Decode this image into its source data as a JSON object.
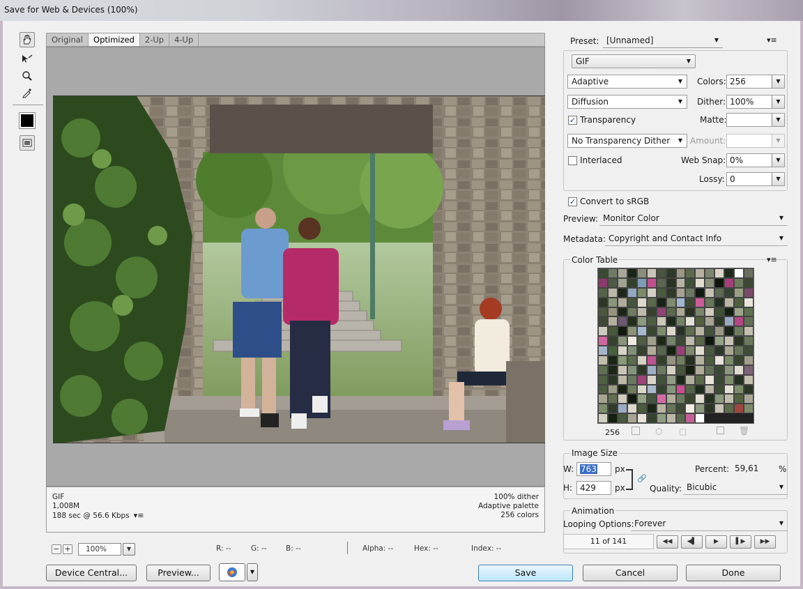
{
  "window": {
    "title": "Save for Web & Devices (100%)"
  },
  "view_tabs": [
    {
      "label": "Original"
    },
    {
      "label": "Optimized"
    },
    {
      "label": "2-Up"
    },
    {
      "label": "4-Up"
    }
  ],
  "preview_status": {
    "format": "GIF",
    "size": "1,008M",
    "time": "188 sec @ 56.6 Kbps",
    "dither": "100% dither",
    "palette": "Adaptive palette",
    "colors": "256 colors"
  },
  "zoom_bar": {
    "zoom": "100%",
    "r": "R: --",
    "g": "G: --",
    "b": "B: --",
    "alpha": "Alpha: --",
    "hex": "Hex: --",
    "index": "Index: --"
  },
  "settings": {
    "preset_label": "Preset:",
    "preset_value": "[Unnamed]",
    "format": "GIF",
    "reduction": "Adaptive",
    "colors_label": "Colors:",
    "colors_value": "256",
    "dither_algo": "Diffusion",
    "dither_label": "Dither:",
    "dither_value": "100%",
    "transparency_label": "Transparency",
    "transparency_checked": true,
    "matte_label": "Matte:",
    "matte_value": "",
    "transparency_dither": "No Transparency Dither",
    "amount_label": "Amount:",
    "amount_value": "",
    "interlaced_label": "Interlaced",
    "interlaced_checked": false,
    "websnap_label": "Web Snap:",
    "websnap_value": "0%",
    "lossy_label": "Lossy:",
    "lossy_value": "0",
    "convert_srgb_label": "Convert to sRGB",
    "convert_srgb_checked": true,
    "preview_label": "Preview:",
    "preview_value": "Monitor Color",
    "metadata_label": "Metadata:",
    "metadata_value": "Copyright and Contact Info"
  },
  "color_table": {
    "title": "Color Table",
    "count": "256",
    "swatches": [
      "#3a4a33",
      "#6e7a66",
      "#a9a79a",
      "#1a2418",
      "#8a8f7c",
      "#c9c4b6",
      "#4a5240",
      "#2e3828",
      "#9c9685",
      "#5d6a4e",
      "#b5b0a0",
      "#7a8470",
      "#d9d4c8",
      "#202a1c",
      "#ffffff",
      "#6a6f5e",
      "#8c3a6e",
      "#4d5a45",
      "#a0a48f",
      "#33402c",
      "#7e9bb8",
      "#c24f8d",
      "#5c6650",
      "#2a3322",
      "#b6b3a2",
      "#415038",
      "#e0dcd0",
      "#89917a",
      "#0e150c",
      "#a83d7c",
      "#6d7c5d",
      "#3b4732",
      "#566349",
      "#bcb8a8",
      "#1e281a",
      "#93a7c2",
      "#7c8a66",
      "#d3cfc2",
      "#4a5a3e",
      "#2f3a28",
      "#a5a291",
      "#6a7860",
      "#111a10",
      "#c6c2b3",
      "#5e6b53",
      "#364330",
      "#98a083",
      "#7b4a6a",
      "#2c3626",
      "#8a967a",
      "#b0ad9c",
      "#46563e",
      "#ddd8cc",
      "#5a6a4b",
      "#192216",
      "#7f8c6f",
      "#a3b6cf",
      "#3e4b35",
      "#ce5c9a",
      "#69775b",
      "#252f20",
      "#b9b6a5",
      "#51613f",
      "#e8e4da",
      "#4b573f",
      "#96937f",
      "#1c2518",
      "#6f7c61",
      "#c0bcad",
      "#35412e",
      "#8e4572",
      "#5b684f",
      "#aba896",
      "#28321f",
      "#7a866b",
      "#d0ccbe",
      "#405034",
      "#14200f",
      "#9ea58a",
      "#60704f",
      "#3d4936",
      "#b2af9e",
      "#6b5a70",
      "#232d1e",
      "#8f9a7e",
      "#4e5d42",
      "#cac6b8",
      "#1f2a19",
      "#738366",
      "#e4e0d6",
      "#52603f",
      "#a7a493",
      "#2e3827",
      "#99aac0",
      "#b74585",
      "#617057",
      "#cdc9bb",
      "#48583c",
      "#121a0f",
      "#8b9477",
      "#a6b8d1",
      "#39462f",
      "#7d8b6a",
      "#dcd8cc",
      "#283224",
      "#5f6d51",
      "#b8b4a3",
      "#43523a",
      "#9a9783",
      "#1a2316",
      "#6e7d60",
      "#c3bfaf",
      "#d1669f",
      "#364230",
      "#88937a",
      "#efebe2",
      "#4f5d44",
      "#a29f8d",
      "#1e2819",
      "#74836a",
      "#3b4834",
      "#bfbbab",
      "#5a6748",
      "#0f170d",
      "#91a485",
      "#c7c3b4",
      "#2b3524",
      "#6c7a5c",
      "#a4b5ca",
      "#466040",
      "#d7d3c6",
      "#82907a",
      "#33402b",
      "#b0ad9a",
      "#576650",
      "#16200f",
      "#9b3f79",
      "#7c896d",
      "#e2ded3",
      "#4a5a41",
      "#2c3727",
      "#aaa794",
      "#687659",
      "#3f4c37",
      "#c1bdad",
      "#1b2517",
      "#8a9a7a",
      "#5c6b4d",
      "#d5d1c4",
      "#bf5290",
      "#33412b",
      "#969480",
      "#70805f",
      "#24301d",
      "#b5b2a1",
      "#4b5b3f",
      "#e6e2d8",
      "#7a8a6a",
      "#38442f",
      "#a19e8b",
      "#5f6e52",
      "#1c2717",
      "#c9c5b6",
      "#84947b",
      "#2d3827",
      "#9fb0c5",
      "#6b7a5f",
      "#d4d0c3",
      "#47563b",
      "#151e11",
      "#aeab99",
      "#627157",
      "#3c4a33",
      "#8d9880",
      "#e0dcd1",
      "#7c6379",
      "#506045",
      "#2a3523",
      "#bdb9a9",
      "#6a7860",
      "#a04378",
      "#d8d4c7",
      "#43523a",
      "#929c84",
      "#1d2818",
      "#b3b09e",
      "#5b6a4d",
      "#e9e5db",
      "#3a4732",
      "#7e8d6d",
      "#263021",
      "#c4c0b0",
      "#4d5c41",
      "#9e9b88",
      "#17210f",
      "#6f7e5f",
      "#dad6ca",
      "#a8b9ce",
      "#34422d",
      "#86957a",
      "#c84d92",
      "#566548",
      "#1f2a1a",
      "#bab6a6",
      "#3f4c36",
      "#e3dfd4",
      "#7d8c6c",
      "#2b3625",
      "#a6a390",
      "#5f6e4f",
      "#cfcbbe",
      "#101a0e",
      "#93a082",
      "#465540",
      "#d36aa4",
      "#b1ae9c",
      "#6c7b5e",
      "#39462f",
      "#e1ddd2",
      "#23301d",
      "#8c9a7c",
      "#c2beae",
      "#52613f",
      "#a9a695",
      "#7c8d6e",
      "#2f3a2a",
      "#9aabc3",
      "#dcd8cd",
      "#4a5a3c",
      "#1a2516",
      "#b8b4a2",
      "#66755a",
      "#3b4934",
      "#f1ede4",
      "#89977e",
      "#2a3524",
      "#c8c4b5",
      "#5c6c4b",
      "#a0473f",
      "#7a8a6b",
      "#d3cfc1",
      "#142010",
      "#465840",
      "#a8a592",
      "#e7e3d9",
      "#35432e",
      "#8f9e80",
      "#bbb8a7",
      "#5a6a4c",
      "#c56198",
      "#ffffff"
    ]
  },
  "image_size": {
    "title": "Image Size",
    "w_label": "W:",
    "w_value": "763",
    "h_label": "H:",
    "h_value": "429",
    "px": "px",
    "percent_label": "Percent:",
    "percent_value": "59,61",
    "percent_unit": "%",
    "quality_label": "Quality:",
    "quality_value": "Bicubic"
  },
  "animation": {
    "title": "Animation",
    "looping_label": "Looping Options:",
    "looping_value": "Forever",
    "frame_counter": "11 of 141"
  },
  "bottom_buttons": {
    "device_central": "Device Central...",
    "preview": "Preview...",
    "save": "Save",
    "cancel": "Cancel",
    "done": "Done"
  }
}
